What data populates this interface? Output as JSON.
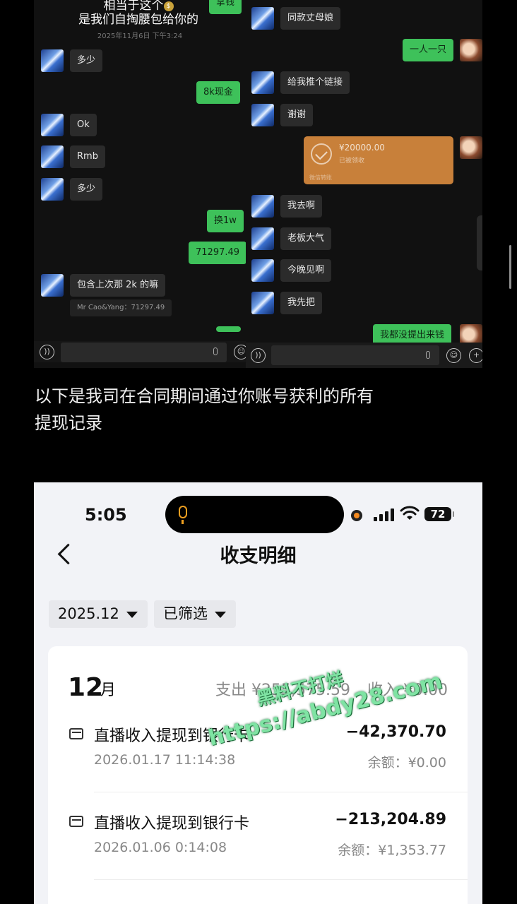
{
  "chat": {
    "caption_line1": "相当于这个",
    "caption_coin": "$",
    "caption_line2": "是我们自掏腰包给你的",
    "caption_time": "2025年11月6日 下午3:24",
    "left_messages": [
      {
        "dir": "out",
        "text": "拿钱"
      },
      {
        "dir": "in",
        "text": "多少"
      },
      {
        "dir": "out",
        "text": "8k现金"
      },
      {
        "dir": "in",
        "text": "Ok"
      },
      {
        "dir": "in",
        "text": "Rmb"
      },
      {
        "dir": "in",
        "text": "多少"
      },
      {
        "dir": "out",
        "text": "换1w"
      },
      {
        "dir": "out",
        "text": "71297.49"
      },
      {
        "dir": "in",
        "text": "包含上次那 2k 的嘛"
      }
    ],
    "left_quote": "Mr Cao&Yang：71297.49",
    "right_messages": [
      {
        "dir": "in",
        "text": "同款丈母娘"
      },
      {
        "dir": "out",
        "text": "一人一只"
      },
      {
        "dir": "in",
        "text": "给我推个链接"
      },
      {
        "dir": "in",
        "text": "谢谢"
      },
      {
        "dir": "in",
        "text": "我去啊"
      },
      {
        "dir": "in",
        "text": "老板大气"
      },
      {
        "dir": "in",
        "text": "今晚见啊"
      },
      {
        "dir": "in",
        "text": "我先把"
      },
      {
        "dir": "out",
        "text": "我都没提出来钱"
      }
    ],
    "transfer": {
      "amount": "¥20000.00",
      "status": "已被领收",
      "source": "微信转账"
    }
  },
  "mid_text": {
    "line1": "以下是我司在合同期间通过你账号获利的所有",
    "line2": "提现记录"
  },
  "phone": {
    "status_time": "5:05",
    "battery": "72",
    "page_title": "收支明细",
    "filters": {
      "date": "2025.12",
      "status": "已筛选"
    },
    "month": {
      "num": "12",
      "unit": "月"
    },
    "summary": {
      "expense": "支出 ¥255,575.59",
      "income": "收入 ¥0.00"
    },
    "transactions": [
      {
        "title": "直播收入提现到银行卡",
        "amount": "−42,370.70",
        "date": "2026.01.17 11:14:38",
        "balance": "余额：¥0.00"
      },
      {
        "title": "直播收入提现到银行卡",
        "amount": "−213,204.89",
        "date": "2026.01.06 0:14:08",
        "balance": "余额：¥1,353.77"
      }
    ]
  },
  "watermark": {
    "line1": "黑料不打烊",
    "line2": "https://abdy28.com"
  },
  "colors": {
    "wechat_green": "#3ec15a",
    "transfer_orange": "#c8803a",
    "background": "#000000",
    "watermark_green": "#7fe3a3"
  }
}
